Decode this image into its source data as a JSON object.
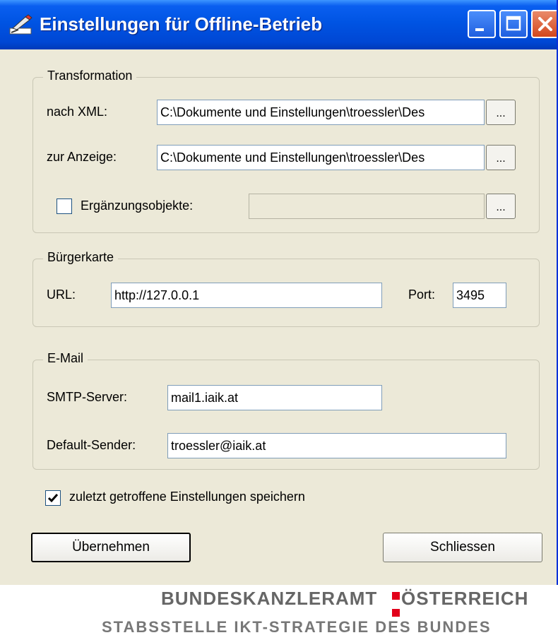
{
  "window": {
    "title": "Einstellungen für Offline-Betrieb"
  },
  "transformation": {
    "legend": "Transformation",
    "nach_xml_label": "nach XML:",
    "nach_xml_value": "C:\\Dokumente und Einstellungen\\troessler\\Des",
    "zur_anzeige_label": "zur Anzeige:",
    "zur_anzeige_value": "C:\\Dokumente und Einstellungen\\troessler\\Des",
    "ergaenzung_label": "Ergänzungsobjekte:",
    "ergaenzung_value": "",
    "ergaenzung_checked": false,
    "browse_label": "..."
  },
  "buergerkarte": {
    "legend": "Bürgerkarte",
    "url_label": "URL:",
    "url_value": "http://127.0.0.1",
    "port_label": "Port:",
    "port_value": "3495"
  },
  "email": {
    "legend": "E-Mail",
    "smtp_label": "SMTP-Server:",
    "smtp_value": "mail1.iaik.at",
    "sender_label": "Default-Sender:",
    "sender_value": "troessler@iaik.at"
  },
  "save_settings": {
    "label": "zuletzt getroffene Einstellungen speichern",
    "checked": true
  },
  "buttons": {
    "apply": "Übernehmen",
    "close": "Schliessen"
  },
  "footer": {
    "line1_left": "BUNDESKANZLERAMT",
    "line1_right": "ÖSTERREICH",
    "line2": "STABSSTELLE IKT-STRATEGIE DES BUNDES",
    "mark_color": "#e2001a"
  }
}
